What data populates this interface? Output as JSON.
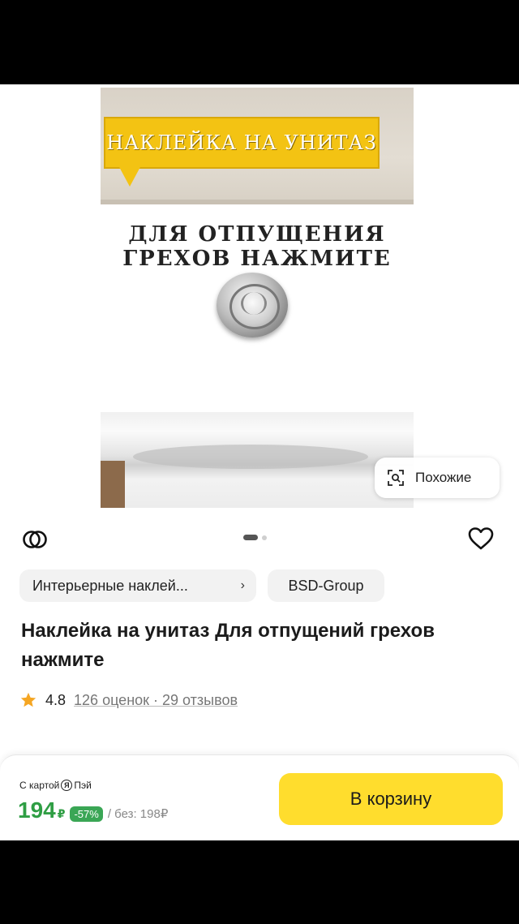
{
  "product_image": {
    "banner_text": "НАКЛЕЙКА НА УНИТАЗ",
    "caption_line1": "ДЛЯ ОТПУЩЕНИЯ",
    "caption_line2": "ГРЕХОВ НАЖМИТЕ"
  },
  "similar_button": {
    "label": "Похожие",
    "icon": "visual-search-icon"
  },
  "gallery": {
    "total_images": 2,
    "active_index": 0
  },
  "chips": {
    "category": "Интерьерные наклей...",
    "category_chevron": "›",
    "brand": "BSD-Group"
  },
  "product": {
    "title": "Наклейка на унитаз Для отпущений грехов нажмите",
    "rating": "4.8",
    "reviews": "126 оценок · 29 отзывов"
  },
  "buy_bar": {
    "card_note_prefix": "С картой",
    "card_note_badge": "Я",
    "card_note_suffix": "Пэй",
    "price": "194",
    "currency": "₽",
    "discount": "-57%",
    "old_price": "/ без: 198₽",
    "cart_button": "В корзину"
  },
  "colors": {
    "accent_yellow": "#ffdd2d",
    "price_green": "#2f9e44",
    "star": "#f5a623"
  }
}
